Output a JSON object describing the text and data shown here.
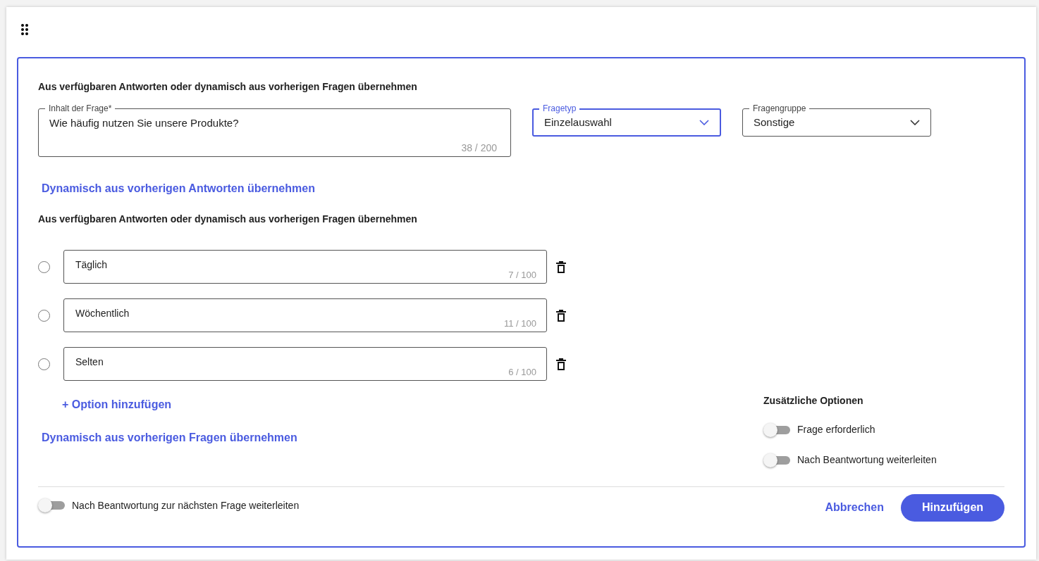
{
  "heading_top": "Aus verfügbaren Antworten oder dynamisch aus vorherigen Fragen übernehmen",
  "question_field": {
    "label": "Inhalt der Frage*",
    "value": "Wie häufig nutzen Sie unsere Produkte?",
    "counter": "38 / 200"
  },
  "selects": [
    {
      "label": "Fragetyp",
      "value": "Einzelauswahl",
      "focused": true
    },
    {
      "label": "Fragengruppe",
      "value": "Sonstige",
      "focused": false
    }
  ],
  "link_answers": "Dynamisch aus vorherigen Antworten übernehmen",
  "heading_options": "Aus verfügbaren Antworten oder dynamisch aus vorherigen Fragen übernehmen",
  "options": [
    {
      "text": "Täglich",
      "counter": "7 / 100",
      "selected": false
    },
    {
      "text": "Wöchentlich",
      "counter": "11 / 100",
      "selected": false
    },
    {
      "text": "Selten",
      "counter": "6 / 100",
      "selected": false
    }
  ],
  "add_option": "+ Option hinzufügen",
  "link_questions": "Dynamisch aus vorherigen Fragen übernehmen",
  "additional_options": {
    "title": "Zusätzliche Optionen",
    "toggles": [
      {
        "label": "Frage erforderlich",
        "on": false
      },
      {
        "label": "Nach Beantwortung weiterleiten",
        "on": false
      }
    ]
  },
  "footer": {
    "toggle": {
      "label": "Nach Beantwortung zur nächsten Frage weiterleiten",
      "on": false
    },
    "cancel": "Abbrechen",
    "submit": "Hinzufügen"
  }
}
